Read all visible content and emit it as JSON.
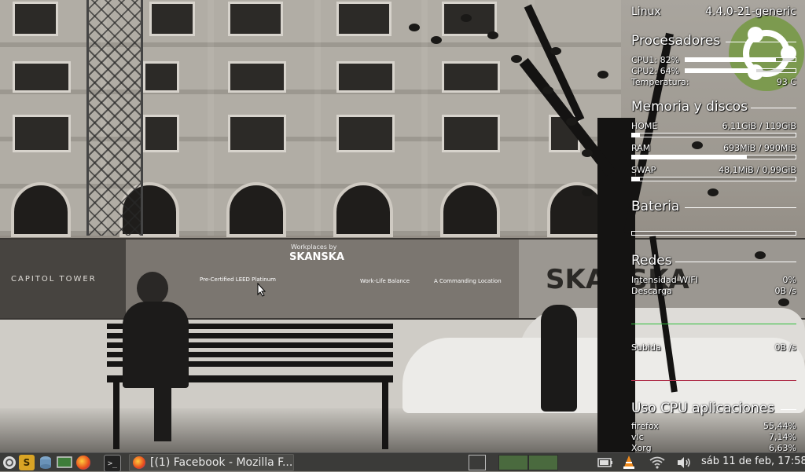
{
  "conky": {
    "os": "Linux",
    "kernel": "4.4.0-21-generic",
    "processors": {
      "title": "Procesadores",
      "cpu1_label": "CPU1: 82%",
      "cpu1_usage": 82,
      "cpu2_label": "CPU2: 64%",
      "cpu2_usage": 64,
      "temp_label": "Temperatura:",
      "temp_value": "93 C"
    },
    "memory": {
      "title": "Memoria y discos",
      "home_label": "HOME",
      "home_value": "6,11GiB / 119GiB",
      "home_fraction": 0.05,
      "ram_label": "RAM",
      "ram_value": "693MiB / 990MiB",
      "ram_fraction": 0.7,
      "swap_label": "SWAP",
      "swap_value": "48,1MiB / 0,99GiB",
      "swap_fraction": 0.05
    },
    "battery": {
      "title": "Bateria"
    },
    "network": {
      "title": "Redes",
      "wifi_label": "Intensidad WIFI",
      "wifi_value": "0%",
      "download_label": "Descarga",
      "download_value": "0B  /s",
      "upload_label": "Subida",
      "upload_value": "0B  /s"
    },
    "apps": {
      "title": "Uso CPU aplicaciones",
      "items": [
        {
          "name": "firefox",
          "value": "55,44%"
        },
        {
          "name": "vlc",
          "value": "7,14%"
        },
        {
          "name": "Xorg",
          "value": "6,63%"
        }
      ]
    }
  },
  "wallpaper": {
    "sign_left": "CAPITOL TOWER",
    "sign_mid_top": "Workplaces by",
    "sign_mid_brand": "SKANSKA",
    "sign_mid_caption": "Pre-Certified LEED Platinum",
    "sign_mid_caption2": "Work-Life Balance",
    "sign_mid_caption3": "A Commanding Location",
    "sign_right": "SKANSKA"
  },
  "taskbar": {
    "task_title": "[(1) Facebook - Mozilla F...",
    "clock": "sáb 11 de feb, 17:58",
    "icons": [
      "menu-icon",
      "synaptic-icon",
      "database-icon",
      "monitor-icon",
      "firefox-icon",
      "terminal-icon"
    ]
  },
  "colors": {
    "accent_green": "#7c9a4f",
    "graph_download": "#2fbf3a",
    "graph_upload": "#b0304a"
  }
}
